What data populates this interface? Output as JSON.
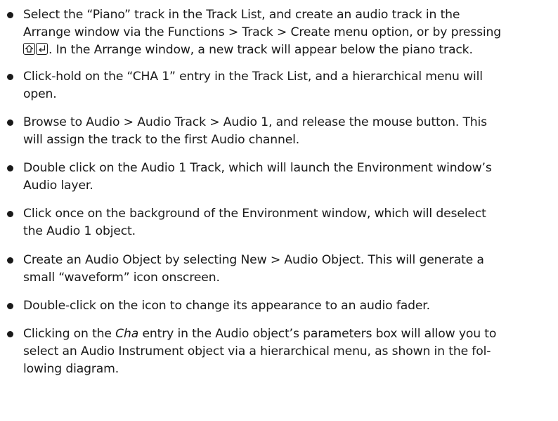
{
  "bullets": [
    {
      "lines": [
        "Select the “Piano” track in the Track List, and create an audio track in the",
        "Arrange window via the Functions > Track > Create menu option, or by pressing"
      ],
      "key_line_tail": ". In the Arrange window, a new track will appear below the piano track.",
      "keys": [
        "shift-key-icon",
        "return-key-icon"
      ]
    },
    {
      "lines": [
        "Click-hold on the “CHA 1” entry in the Track List, and a hierarchical menu will",
        "open."
      ]
    },
    {
      "lines": [
        "Browse to Audio > Audio Track > Audio 1, and release the mouse button. This",
        "will assign the track to the first Audio channel."
      ]
    },
    {
      "lines": [
        "Double click on the Audio 1 Track, which will launch the Environment window’s",
        "Audio layer."
      ]
    },
    {
      "lines": [
        "Click once on the background of the Environment window, which will deselect",
        "the Audio 1 object."
      ]
    },
    {
      "lines": [
        "Create an Audio Object by selecting New > Audio Object. This will generate a",
        "small “waveform” icon onscreen."
      ]
    },
    {
      "lines": [
        "Double-click on the icon to change its appearance to an audio fader."
      ]
    },
    {
      "line1_pre": "Clicking on the ",
      "line1_em": "Cha",
      "line1_post": " entry in the Audio object’s parameters box will allow you to",
      "lines": [
        "select an Audio Instrument object via a hierarchical menu, as shown in the fol-",
        "lowing diagram."
      ]
    }
  ]
}
